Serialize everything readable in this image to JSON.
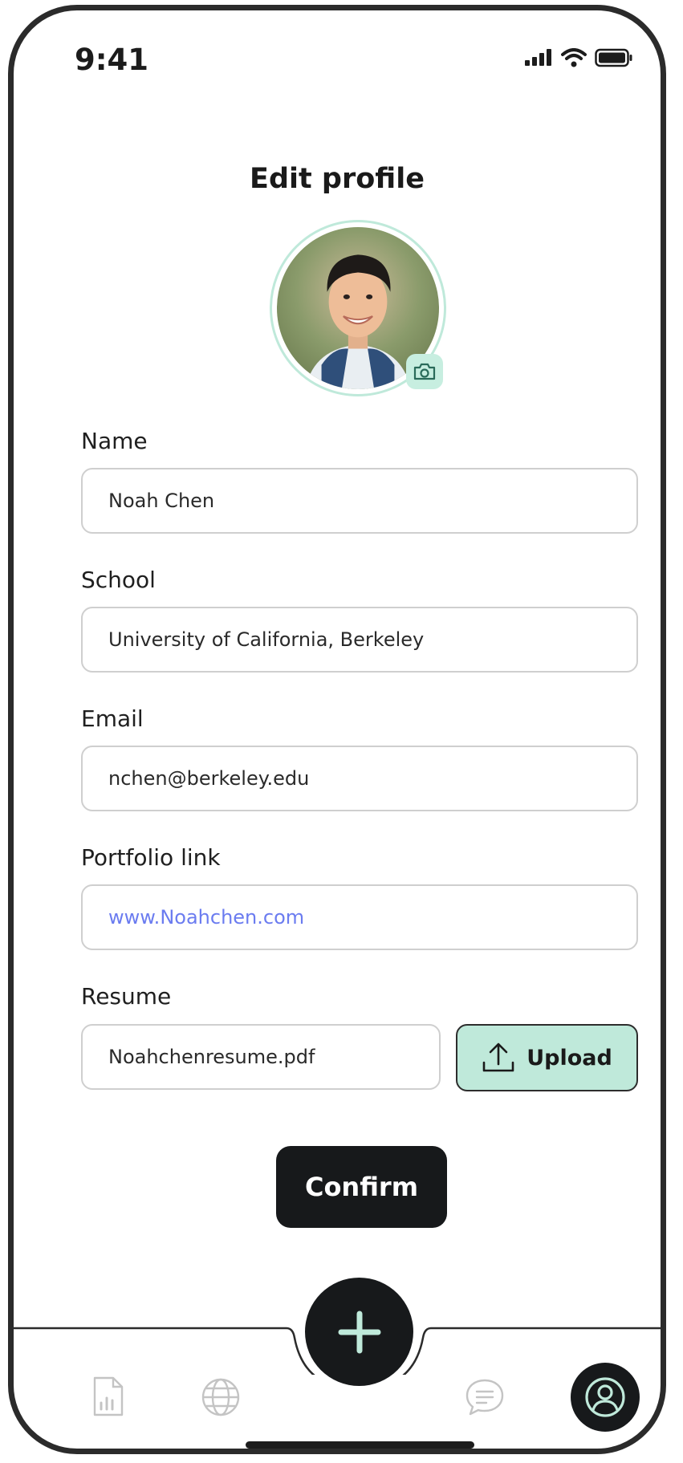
{
  "status_bar": {
    "time": "9:41"
  },
  "header": {
    "title": "Edit profile"
  },
  "form": {
    "name": {
      "label": "Name",
      "value": "Noah Chen"
    },
    "school": {
      "label": "School",
      "value": "University of California, Berkeley"
    },
    "email": {
      "label": "Email",
      "value": "nchen@berkeley.edu"
    },
    "portfolio": {
      "label": "Portfolio link",
      "value": "www.Noahchen.com"
    },
    "resume": {
      "label": "Resume",
      "value": "Noahchenresume.pdf",
      "upload_label": "Upload"
    }
  },
  "actions": {
    "confirm_label": "Confirm"
  },
  "tabbar": {
    "items": [
      {
        "icon": "chart-document-icon"
      },
      {
        "icon": "globe-icon"
      },
      {
        "icon": "plus-icon"
      },
      {
        "icon": "chat-bubble-icon"
      },
      {
        "icon": "user-profile-icon"
      }
    ]
  },
  "colors": {
    "accent": "#bfe9da",
    "dark": "#17191b",
    "link": "#6b7cf0"
  }
}
